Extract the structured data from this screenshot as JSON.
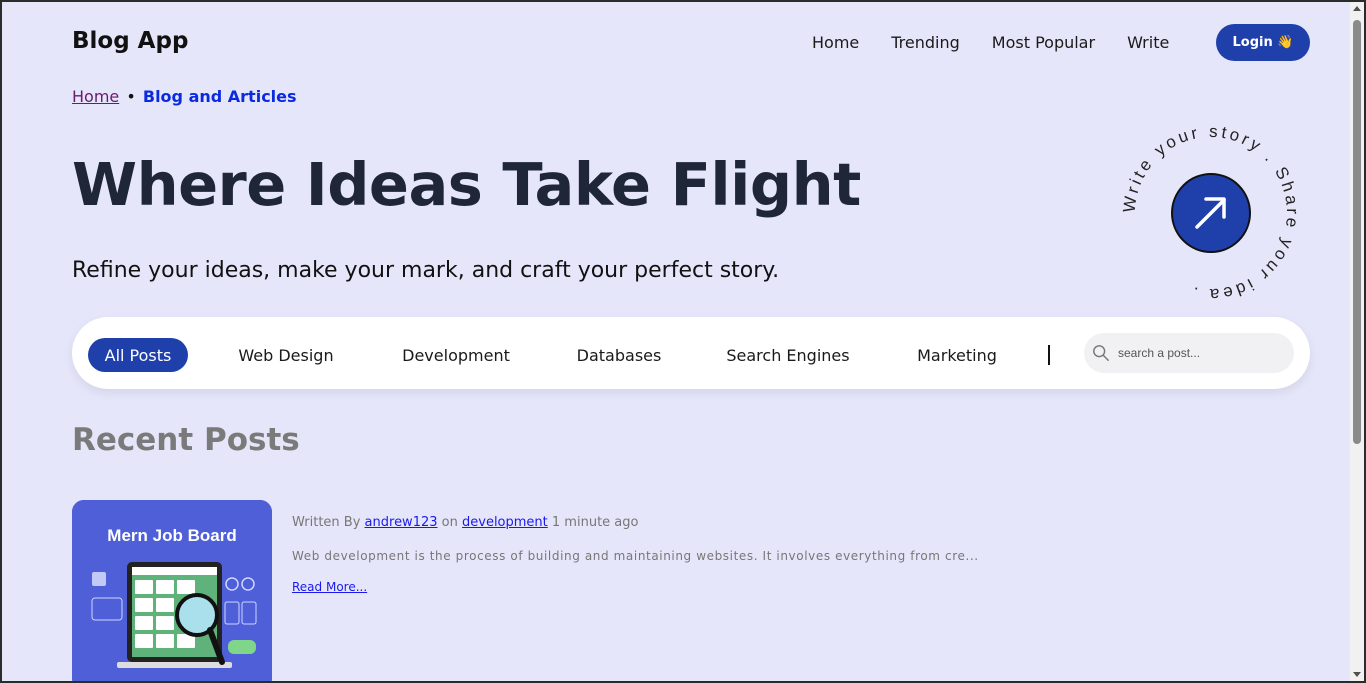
{
  "header": {
    "brand": "Blog App",
    "nav": [
      "Home",
      "Trending",
      "Most Popular",
      "Write"
    ],
    "login_label": "Login 👋"
  },
  "breadcrumb": {
    "home": "Home",
    "separator": "•",
    "current": "Blog and Articles"
  },
  "hero": {
    "title": "Where Ideas Take Flight",
    "subtitle": "Refine your ideas, make your mark, and craft your perfect story."
  },
  "badge": {
    "circular_text": "Write your story . Share your idea .",
    "icon": "arrow-up-right-icon"
  },
  "filters": {
    "categories": [
      "All Posts",
      "Web Design",
      "Development",
      "Databases",
      "Search Engines",
      "Marketing"
    ],
    "active": "All Posts",
    "search_placeholder": "search a post..."
  },
  "recent": {
    "title": "Recent Posts",
    "posts": [
      {
        "thumb_title": "Mern Job Board",
        "written_by_label": "Written By",
        "author": "andrew123",
        "on_label": "on",
        "category": "development",
        "time": "1 minute ago",
        "excerpt": "Web development is the process of building and maintaining websites. It involves everything from cre...",
        "read_more": "Read More..."
      }
    ]
  },
  "colors": {
    "page_bg": "#e6e6fb",
    "accent": "#1f3faa",
    "title": "#1f2638",
    "link": "#1a1aee"
  }
}
